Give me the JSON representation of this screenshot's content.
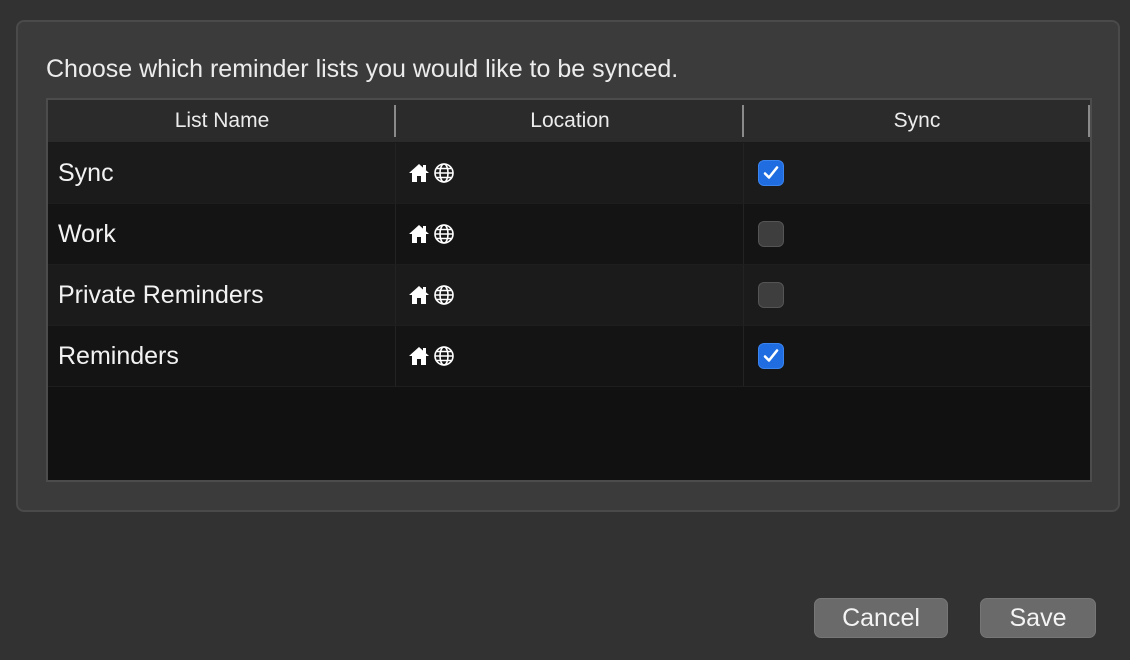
{
  "dialog": {
    "instructions": "Choose which reminder lists you would like to be synced."
  },
  "table": {
    "columns": [
      "List Name",
      "Location",
      "Sync"
    ],
    "rows": [
      {
        "name": "Sync",
        "location_icons": [
          "home-icon",
          "globe-icon"
        ],
        "sync": true
      },
      {
        "name": "Work",
        "location_icons": [
          "home-icon",
          "globe-icon"
        ],
        "sync": false
      },
      {
        "name": "Private Reminders",
        "location_icons": [
          "home-icon",
          "globe-icon"
        ],
        "sync": false
      },
      {
        "name": "Reminders",
        "location_icons": [
          "home-icon",
          "globe-icon"
        ],
        "sync": true
      }
    ]
  },
  "buttons": {
    "cancel_label": "Cancel",
    "save_label": "Save"
  },
  "colors": {
    "background": "#323232",
    "panel": "#3b3b3b",
    "checkbox_checked": "#1f6de0",
    "button": "#6a6a6a"
  }
}
